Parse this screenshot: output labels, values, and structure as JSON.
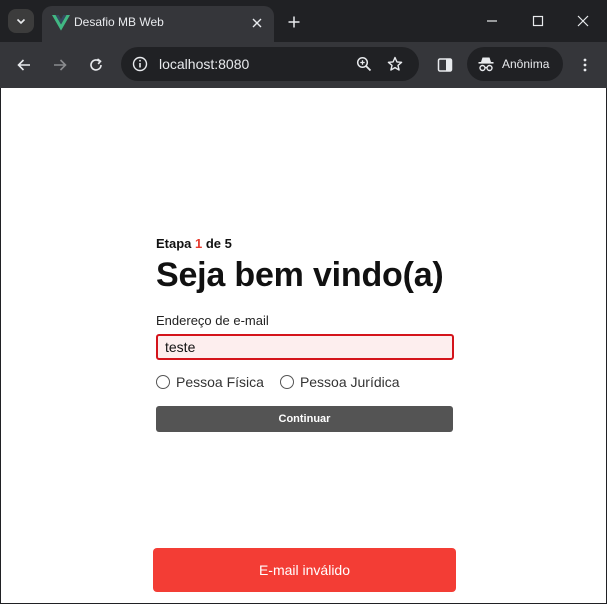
{
  "browser": {
    "tab": {
      "title": "Desafio MB Web",
      "favicon": "vue-logo-icon"
    },
    "omnibox": {
      "url": "localhost:8080"
    },
    "incognito_label": "Anônima",
    "colors": {
      "frame": "#202124",
      "toolbar": "#35363a",
      "text": "#e8eaed"
    }
  },
  "page": {
    "step": {
      "prefix": "Etapa ",
      "current": "1",
      "suffix": " de 5"
    },
    "title": "Seja bem vindo(a)",
    "email": {
      "label": "Endereço de e-mail",
      "value": "teste"
    },
    "person_type": {
      "options": [
        {
          "label": "Pessoa Física",
          "checked": false
        },
        {
          "label": "Pessoa Jurídica",
          "checked": false
        }
      ]
    },
    "continue_label": "Continuar",
    "toast": "E-mail inválido",
    "colors": {
      "accent": "#e63b2e",
      "error_border": "#d4141b",
      "error_bg": "#fdeeee",
      "button": "#545454",
      "toast": "#f33d35"
    }
  }
}
